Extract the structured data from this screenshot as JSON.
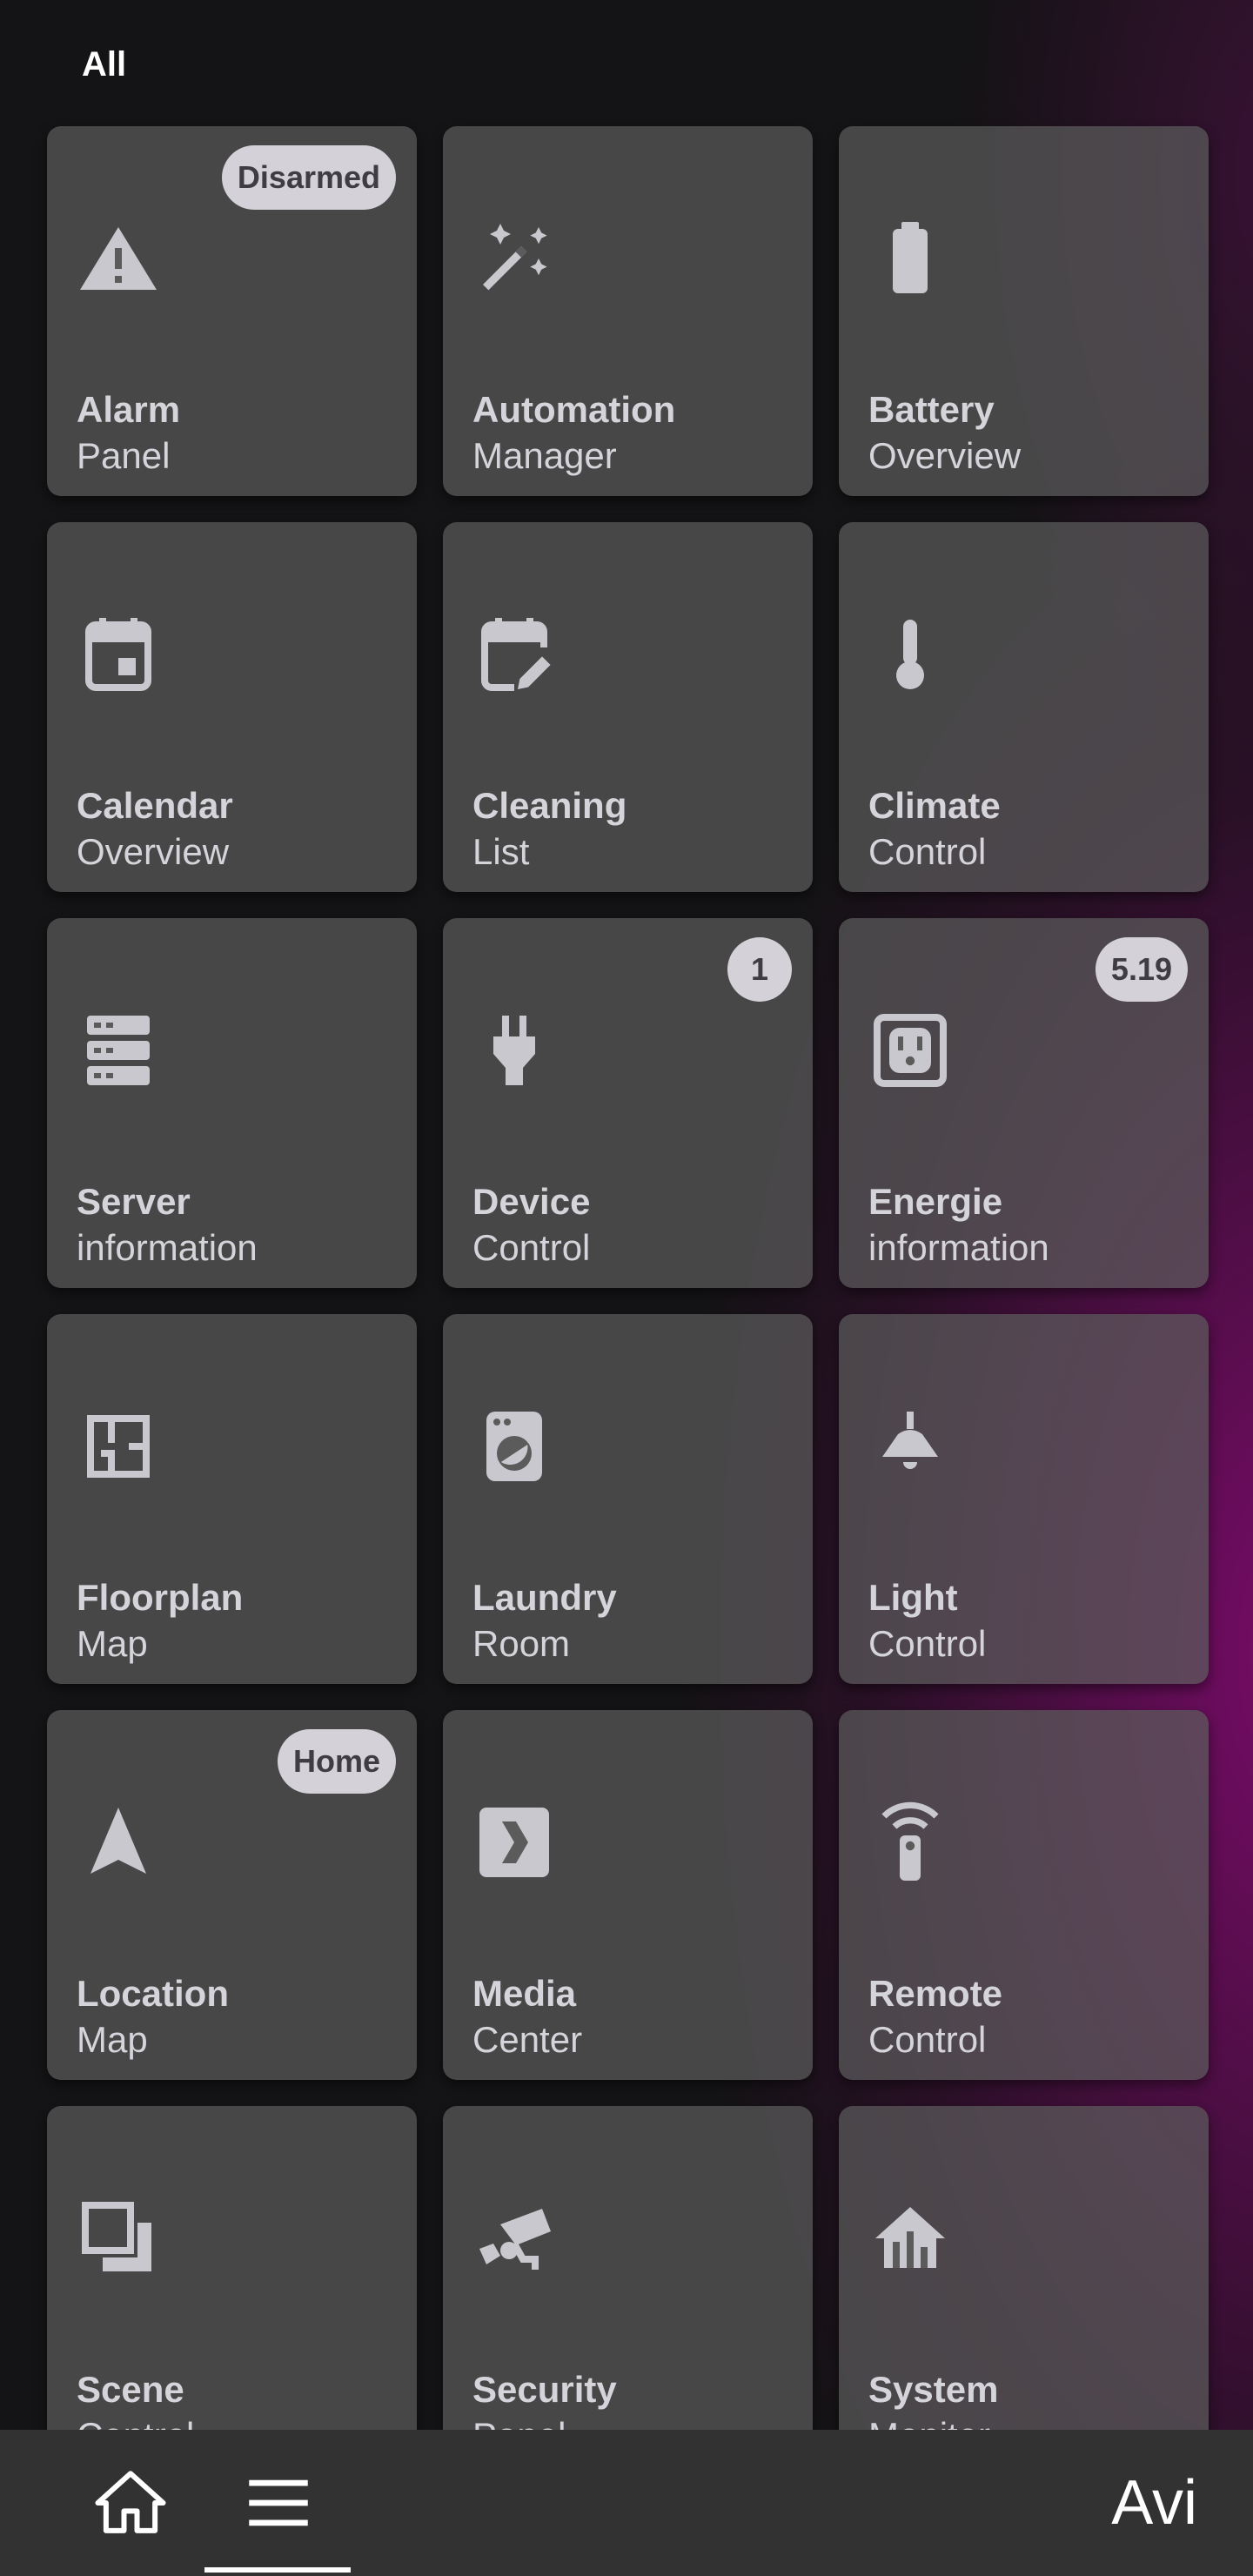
{
  "section": {
    "title": "All"
  },
  "cards": [
    {
      "title": "Alarm",
      "subtitle": "Panel",
      "icon": "alert-icon",
      "badge": "Disarmed"
    },
    {
      "title": "Automation",
      "subtitle": "Manager",
      "icon": "magic-wand-icon",
      "badge": null
    },
    {
      "title": "Battery",
      "subtitle": "Overview",
      "icon": "battery-icon",
      "badge": null
    },
    {
      "title": "Calendar",
      "subtitle": "Overview",
      "icon": "calendar-icon",
      "badge": null
    },
    {
      "title": "Cleaning",
      "subtitle": "List",
      "icon": "calendar-edit-icon",
      "badge": null
    },
    {
      "title": "Climate",
      "subtitle": "Control",
      "icon": "thermometer-icon",
      "badge": null
    },
    {
      "title": "Server",
      "subtitle": "information",
      "icon": "server-icon",
      "badge": null
    },
    {
      "title": "Device",
      "subtitle": "Control",
      "icon": "power-plug-icon",
      "badge": "1"
    },
    {
      "title": "Energie",
      "subtitle": "information",
      "icon": "power-socket-icon",
      "badge": "5.19"
    },
    {
      "title": "Floorplan",
      "subtitle": "Map",
      "icon": "floor-plan-icon",
      "badge": null
    },
    {
      "title": "Laundry",
      "subtitle": "Room",
      "icon": "washing-machine-icon",
      "badge": null
    },
    {
      "title": "Light",
      "subtitle": "Control",
      "icon": "ceiling-light-icon",
      "badge": null
    },
    {
      "title": "Location",
      "subtitle": "Map",
      "icon": "navigation-icon",
      "badge": "Home"
    },
    {
      "title": "Media",
      "subtitle": "Center",
      "icon": "plex-icon",
      "badge": null
    },
    {
      "title": "Remote",
      "subtitle": "Control",
      "icon": "remote-icon",
      "badge": null
    },
    {
      "title": "Scene",
      "subtitle": "Control",
      "icon": "scene-icon",
      "badge": null
    },
    {
      "title": "Security",
      "subtitle": "Panel",
      "icon": "cctv-icon",
      "badge": null
    },
    {
      "title": "System",
      "subtitle": "Monitor",
      "icon": "home-analytics-icon",
      "badge": null
    }
  ],
  "bottom_nav": {
    "home_icon": "home-icon",
    "menu_icon": "menu-icon",
    "user_name": "Avi"
  },
  "colors": {
    "card_text": "#d5d4da",
    "badge_bg": "#d4d2d8",
    "badge_text": "#3f3d42",
    "bottom_bar": "#323232",
    "accent_magenta": "#8c0a78"
  }
}
